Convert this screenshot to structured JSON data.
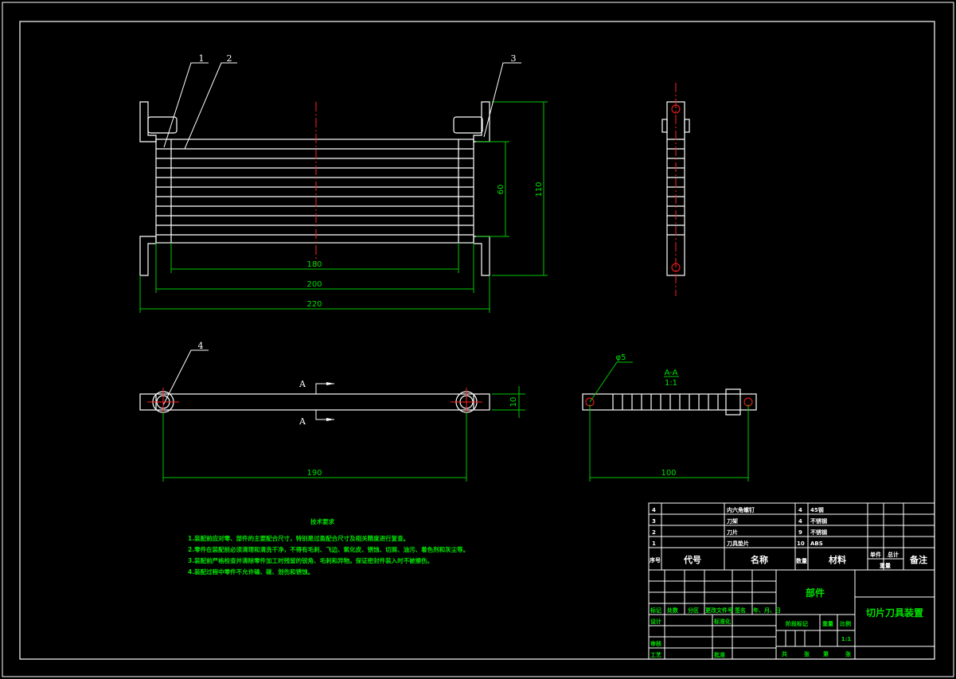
{
  "drawing": {
    "title": "切片刀具装置",
    "part_label": "部件",
    "scale": "1:1"
  },
  "callouts": [
    "1",
    "2",
    "3",
    "4"
  ],
  "dimensions": {
    "d180": "180",
    "d200": "200",
    "d220": "220",
    "d60": "60",
    "d110": "110",
    "d190": "190",
    "d10": "10",
    "d100": "100",
    "phi5": "φ5"
  },
  "section": {
    "label": "A-A",
    "scale": "1:1",
    "mark_top": "A",
    "mark_bottom": "A"
  },
  "notes": {
    "title": "技术要求",
    "lines": [
      "1.装配前应对零、部件的主要配合尺寸，特别是过盈配合尺寸及相关精度进行复查。",
      "2.零件在装配前必须清理和清洗干净，不得有毛刺、飞边、氧化皮、锈蚀、切屑、油污、着色剂和灰尘等。",
      "3.装配前严格检查并清除零件加工时残留的锐角、毛刺和异物。保证密封件装入时不被擦伤。",
      "4.装配过程中零件不允许磕、碰、划伤和锈蚀。"
    ]
  },
  "parts": [
    {
      "no": "4",
      "name": "内六角螺钉",
      "qty": "4",
      "material": "45钢"
    },
    {
      "no": "3",
      "name": "刀架",
      "qty": "4",
      "material": "不锈钢"
    },
    {
      "no": "2",
      "name": "刀片",
      "qty": "9",
      "material": "不锈钢"
    },
    {
      "no": "1",
      "name": "刀具垫片",
      "qty": "10",
      "material": "ABS"
    }
  ],
  "parts_header": {
    "no": "序号",
    "code": "代号",
    "name": "名称",
    "qty": "数量",
    "material": "材料",
    "single": "单件",
    "total": "总计",
    "weight": "重量",
    "remark": "备注"
  },
  "title_block": {
    "mark": "标记",
    "count": "处数",
    "zone": "分区",
    "doc": "更改文件号",
    "sign": "签名",
    "date": "年、月、日",
    "design": "设计",
    "std": "标准化",
    "stage": "阶段标记",
    "weight": "重量",
    "ratio": "比例",
    "check": "审核",
    "process": "工艺",
    "approve": "批准",
    "total_sheets": "共",
    "sheet_unit": "张",
    "sheet_no": "第",
    "sheet_unit2": "张"
  }
}
